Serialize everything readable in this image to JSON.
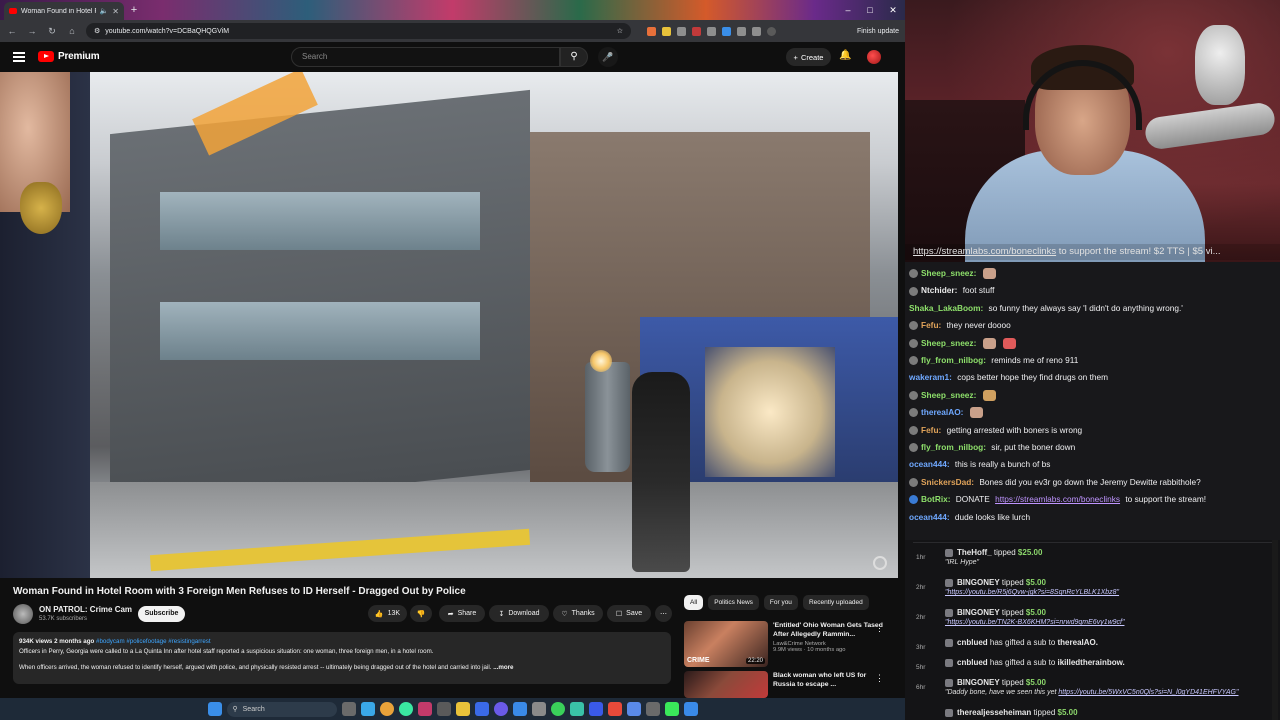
{
  "browser": {
    "tab_title": "Woman Found in Hotel Ro",
    "url": "youtube.com/watch?v=DCBaQHQGViM",
    "finish_update": "Finish update"
  },
  "youtube": {
    "brand": "Premium",
    "search_placeholder": "Search",
    "create_label": "Create",
    "video_title": "Woman Found in Hotel Room with 3 Foreign Men Refuses to ID Herself - Dragged Out by Police",
    "channel_name": "ON PATROL: Crime Cam",
    "channel_subs": "53.7K subscribers",
    "subscribe_label": "Subscribe",
    "like_count": "13K",
    "share_label": "Share",
    "download_label": "Download",
    "thanks_label": "Thanks",
    "save_label": "Save",
    "desc_meta": "934K views  2 months ago",
    "desc_tags": "#bodycam #policefootage #resistingarrest",
    "desc_line1": "Officers in Perry, Georgia were called to a La Quinta Inn after hotel staff reported a suspicious situation: one woman, three foreign men, in a hotel room.",
    "desc_line2": "When officers arrived, the woman refused to identify herself, argued with police, and physically resisted arrest -- ultimately being dragged out of the hotel and carried into jail.",
    "desc_more": "...more",
    "chips": [
      "All",
      "Politics News",
      "For you",
      "Recently uploaded"
    ],
    "reco": [
      {
        "title": "'Entitled' Ohio Woman Gets Tased After Allegedly Rammin...",
        "channel": "Law&Crime Network",
        "meta": "9.9M views · 10 months ago",
        "duration": "22:20",
        "thumb_label": "CRIME"
      },
      {
        "title": "Black woman who left US for Russia to escape ...",
        "channel": "",
        "meta": "",
        "duration": "",
        "thumb_label": ""
      }
    ]
  },
  "taskbar": {
    "search_label": "Search"
  },
  "stream": {
    "banner_link": "https://streamlabs.com/boneclinks",
    "banner_text": " to support the stream! $2 TTS | $5 vi..."
  },
  "chat": [
    {
      "user": "Sheep_sneez:",
      "text": "",
      "color": "#8ee06b",
      "badge": "#7b7b7b",
      "emotes": 1
    },
    {
      "user": "Ntchider:",
      "text": " foot stuff",
      "color": "#e8e8e8",
      "badge": "#7b7b7b",
      "emotes": 0
    },
    {
      "user": "Shaka_LakaBoom:",
      "text": " so funny they always say 'I didn't do anything wrong.'",
      "color": "#8ee06b",
      "badge": "",
      "emotes": 0
    },
    {
      "user": "Fefu:",
      "text": " they never doooo",
      "color": "#e0a35a",
      "badge": "#7b7b7b",
      "emotes": 0
    },
    {
      "user": "Sheep_sneez:",
      "text": "",
      "color": "#8ee06b",
      "badge": "#7b7b7b",
      "emotes": 2
    },
    {
      "user": "fly_from_nilbog:",
      "text": " reminds me of reno 911",
      "color": "#8ee06b",
      "badge": "#7b7b7b",
      "emotes": 0
    },
    {
      "user": "wakeram1:",
      "text": " cops better hope they find drugs on them",
      "color": "#6fa8ff",
      "badge": "",
      "emotes": 0
    },
    {
      "user": "Sheep_sneez:",
      "text": "",
      "color": "#8ee06b",
      "badge": "#7b7b7b",
      "emotes": 1
    },
    {
      "user": "therealAO:",
      "text": "",
      "color": "#6fa8ff",
      "badge": "#7b7b7b",
      "emotes": 1
    },
    {
      "user": "Fefu:",
      "text": " getting arrested with boners is wrong",
      "color": "#e0a35a",
      "badge": "#7b7b7b",
      "emotes": 0
    },
    {
      "user": "fly_from_nilbog:",
      "text": " sir, put the boner down",
      "color": "#8ee06b",
      "badge": "#7b7b7b",
      "emotes": 0
    },
    {
      "user": "ocean444:",
      "text": " this is really a bunch of bs",
      "color": "#6fa8ff",
      "badge": "",
      "emotes": 0
    },
    {
      "user": "SnickersDad:",
      "text": " Bones did you ev3r go down the Jeremy Dewitte rabbithole?",
      "color": "#e0a35a",
      "badge": "#7b7b7b",
      "emotes": 0
    },
    {
      "user": "BotRix:",
      "text": " DONATE ",
      "link": "https://streamlabs.com/boneclinks",
      "after": " to support the stream!",
      "color": "#8ee06b",
      "badge": "#3a7bd5",
      "emotes": 0
    },
    {
      "user": "ocean444:",
      "text": " dude looks like lurch",
      "color": "#6fa8ff",
      "badge": "",
      "emotes": 0
    }
  ],
  "events": [
    {
      "time": "1hr",
      "user": "TheHoff_",
      "action": " tipped ",
      "amount": "$25.00",
      "note": "\"IRL Hype\"",
      "note_link": ""
    },
    {
      "time": "2hr",
      "user": "BINGONEY",
      "action": " tipped ",
      "amount": "$5.00",
      "note": "",
      "note_link": "\"https://youtu.be/R5j6Qvw-jgk?si=8SqnRcYLBLK1Xbz8\""
    },
    {
      "time": "2hr",
      "user": "BINGONEY",
      "action": " tipped ",
      "amount": "$5.00",
      "note": "",
      "note_link": "\"https://youtu.be/TN2K-BX6KHM?si=nrwd9qmE6vy1w9cf\""
    },
    {
      "time": "3hr",
      "user": "cnblued",
      "action": " has gifted a sub to ",
      "amount": "",
      "target": "therealAO.",
      "note": "",
      "note_link": ""
    },
    {
      "time": "5hr",
      "user": "cnblued",
      "action": " has gifted a sub to ",
      "amount": "",
      "target": "ikilledtherainbow.",
      "note": "",
      "note_link": ""
    },
    {
      "time": "6hr",
      "user": "BINGONEY",
      "action": " tipped ",
      "amount": "$5.00",
      "note": "\"Daddy bone, have we seen this yet ",
      "note_link": "https://youtu.be/5WxVC5n0Qls?si=N_l0gYD41EHFVYAG\""
    },
    {
      "time": "",
      "user": "therealjesseheiman",
      "action": " tipped ",
      "amount": "$5.00",
      "note": "",
      "note_link": ""
    }
  ]
}
